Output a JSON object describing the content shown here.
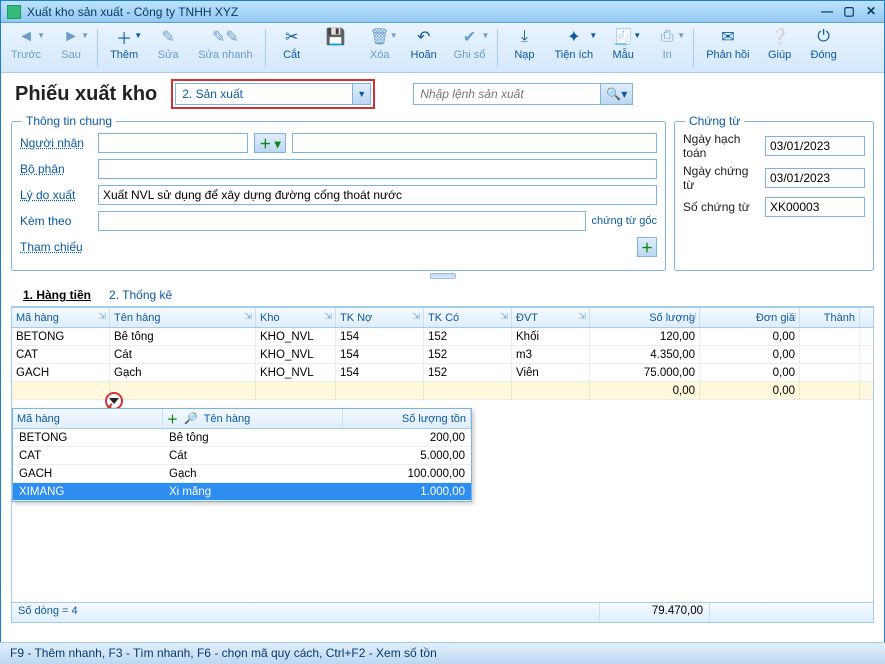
{
  "window": {
    "title": "Xuất kho sản xuất - Công ty TNHH XYZ"
  },
  "toolbar": [
    {
      "key": "prev",
      "label": "Trước",
      "icon": "◄",
      "disabled": true,
      "dd": true
    },
    {
      "key": "next",
      "label": "Sau",
      "icon": "►",
      "disabled": true,
      "dd": true
    },
    {
      "key": "add",
      "label": "Thêm",
      "icon": "＋",
      "disabled": false,
      "dd": true
    },
    {
      "key": "edit",
      "label": "Sửa",
      "icon": "✎",
      "disabled": true
    },
    {
      "key": "qedit",
      "label": "Sửa nhanh",
      "icon": "✎✎",
      "disabled": true
    },
    {
      "key": "cut",
      "label": "Cắt",
      "icon": "✂",
      "disabled": false
    },
    {
      "key": "save",
      "label": "",
      "icon": "💾",
      "disabled": false
    },
    {
      "key": "del",
      "label": "Xóa",
      "icon": "🗑",
      "disabled": true,
      "dd": true
    },
    {
      "key": "undo",
      "label": "Hoãn",
      "icon": "↶",
      "disabled": false
    },
    {
      "key": "post",
      "label": "Ghi sổ",
      "icon": "✔",
      "disabled": true,
      "dd": true
    },
    {
      "key": "load",
      "label": "Nạp",
      "icon": "⤓",
      "disabled": false
    },
    {
      "key": "util",
      "label": "Tiện ích",
      "icon": "✦",
      "disabled": false,
      "dd": true
    },
    {
      "key": "tmpl",
      "label": "Mẫu",
      "icon": "🧾",
      "disabled": false,
      "dd": true
    },
    {
      "key": "print",
      "label": "In",
      "icon": "⎙",
      "disabled": true,
      "dd": true
    },
    {
      "key": "fb",
      "label": "Phản hồi",
      "icon": "✉",
      "disabled": false
    },
    {
      "key": "help",
      "label": "Giúp",
      "icon": "❔",
      "disabled": false
    },
    {
      "key": "close",
      "label": "Đóng",
      "icon": "⏻",
      "disabled": false
    }
  ],
  "header": {
    "title": "Phiếu xuất kho",
    "type_value": "2. Sản xuất",
    "search_placeholder": "Nhập lệnh sản xuất"
  },
  "general": {
    "legend": "Thông tin chung",
    "labels": {
      "receiver": "Người nhận",
      "dept": "Bộ phận",
      "reason": "Lý do xuất",
      "attach": "Kèm theo",
      "ref": "Tham chiếu",
      "orig_voucher": "chứng từ gốc"
    },
    "values": {
      "reason": "Xuất NVL sử dụng để xây dựng đường cống thoát nước"
    }
  },
  "doc": {
    "legend": "Chứng từ",
    "labels": {
      "acc_date": "Ngày hạch toán",
      "vch_date": "Ngày chứng từ",
      "vch_no": "Số chứng từ"
    },
    "values": {
      "acc_date": "03/01/2023",
      "vch_date": "03/01/2023",
      "vch_no": "XK00003"
    }
  },
  "tabs": {
    "t1": "1. Hàng tiền",
    "t2": "2. Thống kê"
  },
  "columns": {
    "mahang": "Mã hàng",
    "tenhang": "Tên hàng",
    "kho": "Kho",
    "tkno": "TK Nợ",
    "tkco": "TK Có",
    "dvt": "ĐVT",
    "soluong": "Số lượng",
    "dongia": "Đơn giá",
    "thanh": "Thành"
  },
  "rows": [
    {
      "mh": "BETONG",
      "th": "Bê tông",
      "kho": "KHO_NVL",
      "tkn": "154",
      "tkc": "152",
      "dvt": "Khối",
      "sl": "120,00",
      "dg": "0,00"
    },
    {
      "mh": "CAT",
      "th": "Cát",
      "kho": "KHO_NVL",
      "tkn": "154",
      "tkc": "152",
      "dvt": "m3",
      "sl": "4.350,00",
      "dg": "0,00"
    },
    {
      "mh": "GACH",
      "th": "Gạch",
      "kho": "KHO_NVL",
      "tkn": "154",
      "tkc": "152",
      "dvt": "Viên",
      "sl": "75.000,00",
      "dg": "0,00"
    }
  ],
  "newrow": {
    "sl": "0,00",
    "dg": "0,00"
  },
  "popup": {
    "columns": {
      "mh": "Mã hàng",
      "th": "Tên hàng",
      "sl": "Số lượng tồn"
    },
    "rows": [
      {
        "mh": "BETONG",
        "th": "Bê tông",
        "sl": "200,00"
      },
      {
        "mh": "CAT",
        "th": "Cát",
        "sl": "5.000,00"
      },
      {
        "mh": "GACH",
        "th": "Gạch",
        "sl": "100.000,00"
      },
      {
        "mh": "XIMANG",
        "th": "Xi măng",
        "sl": "1.000,00",
        "selected": true
      }
    ]
  },
  "footer": {
    "rowcount_label": "Số dòng = 4",
    "total_sl": "79.470,00"
  },
  "statusbar": "F9 - Thêm nhanh, F3 - Tìm nhanh, F6 - chọn mã quy cách, Ctrl+F2 - Xem số tồn"
}
